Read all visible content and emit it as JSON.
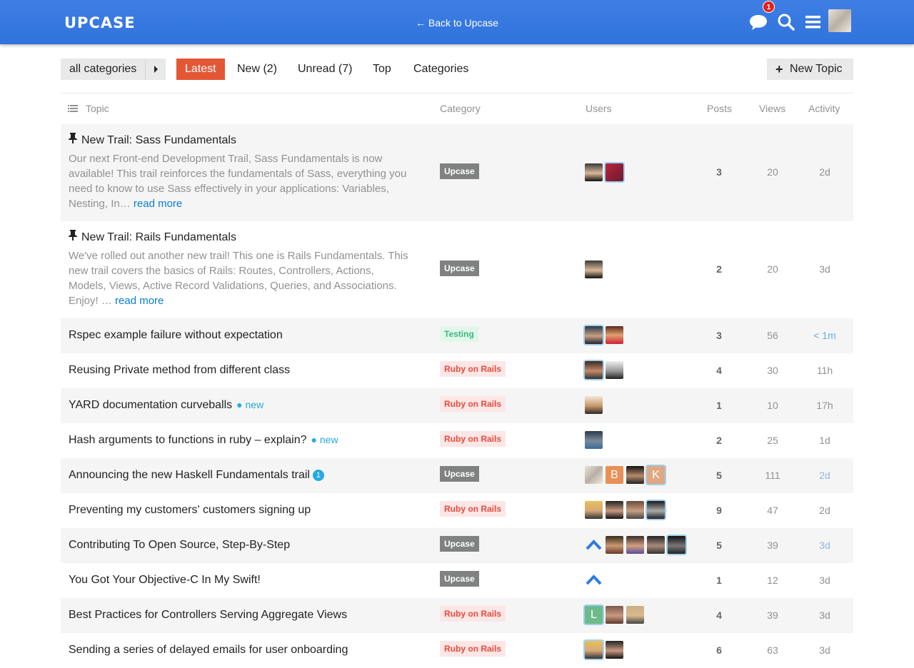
{
  "header": {
    "logo": "UPCASE",
    "back_link": "← Back to Upcase",
    "notification_count": "1",
    "icons": [
      "chat-icon",
      "search-icon",
      "hamburger-menu-icon"
    ]
  },
  "nav": {
    "category_dropdown": "all categories",
    "tabs": [
      {
        "label": "Latest",
        "active": true
      },
      {
        "label": "New (2)",
        "active": false
      },
      {
        "label": "Unread (7)",
        "active": false
      },
      {
        "label": "Top",
        "active": false
      },
      {
        "label": "Categories",
        "active": false
      }
    ],
    "new_topic": "New Topic"
  },
  "columns": {
    "topic": "Topic",
    "category": "Category",
    "users": "Users",
    "posts": "Posts",
    "views": "Views",
    "activity": "Activity"
  },
  "colors": {
    "header_blue": "#3a7be0",
    "accent_red": "#e45735",
    "upcase_category": "#808281",
    "rails_category": "#e74c3c",
    "testing_category": "#3ab97a",
    "new_badge": "#25aae2"
  },
  "topics": [
    {
      "title": "New Trail: Sass Fundamentals",
      "pinned": true,
      "excerpt": "Our next Front-end Development Trail, Sass Fundamentals is now available! This trail reinforces the fundamentals of Sass, everything you need to know to use Sass effectively in your applications: Variables, Nesting, In…",
      "read_more": "read more",
      "category": "Upcase",
      "posts": "3",
      "views": "20",
      "activity": "2d"
    },
    {
      "title": "New Trail: Rails Fundamentals",
      "pinned": true,
      "excerpt": "We've rolled out another new trail! This one is Rails Fundamentals. This new trail covers the basics of Rails: Routes, Controllers, Actions, Models, Views, Active Record Validations, Queries, and Associations. Enjoy! …",
      "read_more": "read more",
      "category": "Upcase",
      "posts": "2",
      "views": "20",
      "activity": "3d"
    },
    {
      "title": "Rspec example failure without expectation",
      "category": "Testing",
      "posts": "3",
      "views": "56",
      "activity": "< 1m"
    },
    {
      "title": "Reusing Private method from different class",
      "category": "Ruby on Rails",
      "posts": "4",
      "views": "30",
      "activity": "11h"
    },
    {
      "title": "YARD documentation curveballs",
      "new_label": "new",
      "category": "Ruby on Rails",
      "posts": "1",
      "views": "10",
      "activity": "17h"
    },
    {
      "title": "Hash arguments to functions in ruby – explain?",
      "new_label": "new",
      "category": "Ruby on Rails",
      "posts": "2",
      "views": "25",
      "activity": "1d"
    },
    {
      "title": "Announcing the new Haskell Fundamentals trail",
      "unread": "1",
      "category": "Upcase",
      "posts": "5",
      "views": "111",
      "activity": "2d",
      "avatar_letters": [
        "B",
        "K"
      ]
    },
    {
      "title": "Preventing my customers' customers signing up",
      "category": "Ruby on Rails",
      "posts": "9",
      "views": "47",
      "activity": "2d"
    },
    {
      "title": "Contributing To Open Source, Step-By-Step",
      "category": "Upcase",
      "posts": "5",
      "views": "39",
      "activity": "3d"
    },
    {
      "title": "You Got Your Objective-C In My Swift!",
      "category": "Upcase",
      "posts": "1",
      "views": "12",
      "activity": "3d"
    },
    {
      "title": "Best Practices for Controllers Serving Aggregate Views",
      "category": "Ruby on Rails",
      "posts": "4",
      "views": "39",
      "activity": "3d",
      "avatar_letters": [
        "L"
      ]
    },
    {
      "title": "Sending a series of delayed emails for user onboarding",
      "category": "Ruby on Rails",
      "posts": "6",
      "views": "63",
      "activity": "3d"
    }
  ]
}
